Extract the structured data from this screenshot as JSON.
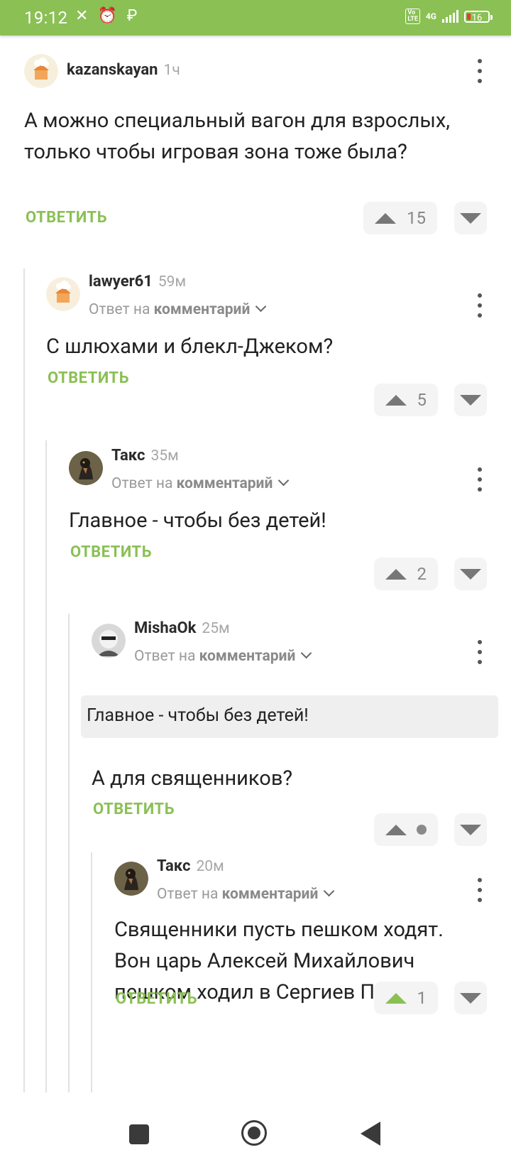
{
  "status_bar": {
    "time": "19:12",
    "status_icons": "✕ ⏰ ₽",
    "network": "4G",
    "volte": "Vo LTE",
    "battery": "16"
  },
  "comments": [
    {
      "user": "kazanskayan",
      "time": "1ч",
      "text": "А можно специальный вагон для взрослых, только чтобы игровая зона тоже была?",
      "reply_label": "ОТВЕТИТЬ",
      "rating": "15"
    },
    {
      "user": "lawyer61",
      "time": "59м",
      "reply_prefix": "Ответ на",
      "reply_link": "комментарий",
      "text": "С шлюхами и блекл-Джеком?",
      "reply_label": "ОТВЕТИТЬ",
      "rating": "5"
    },
    {
      "user": "Такс",
      "time": "35м",
      "reply_prefix": "Ответ на",
      "reply_link": "комментарий",
      "text": "Главное - чтобы без детей!",
      "reply_label": "ОТВЕТИТЬ",
      "rating": "2"
    },
    {
      "user": "MishaOk",
      "time": "25м",
      "reply_prefix": "Ответ на",
      "reply_link": "комментарий",
      "quote": "Главное - чтобы без детей!",
      "text": "А для священников?",
      "reply_label": "ОТВЕТИТЬ",
      "rating": ""
    },
    {
      "user": "Такс",
      "time": "20м",
      "reply_prefix": "Ответ на",
      "reply_link": "комментарий",
      "text": "Священники пусть пешком ходят. Вон царь Алексей Михайлович пешком ходил в Сергиев Посад.",
      "reply_label": "ОТВЕТИТЬ",
      "rating": "1"
    }
  ],
  "colors": {
    "accent": "#8ac054",
    "status_bar": "#8ac054"
  }
}
